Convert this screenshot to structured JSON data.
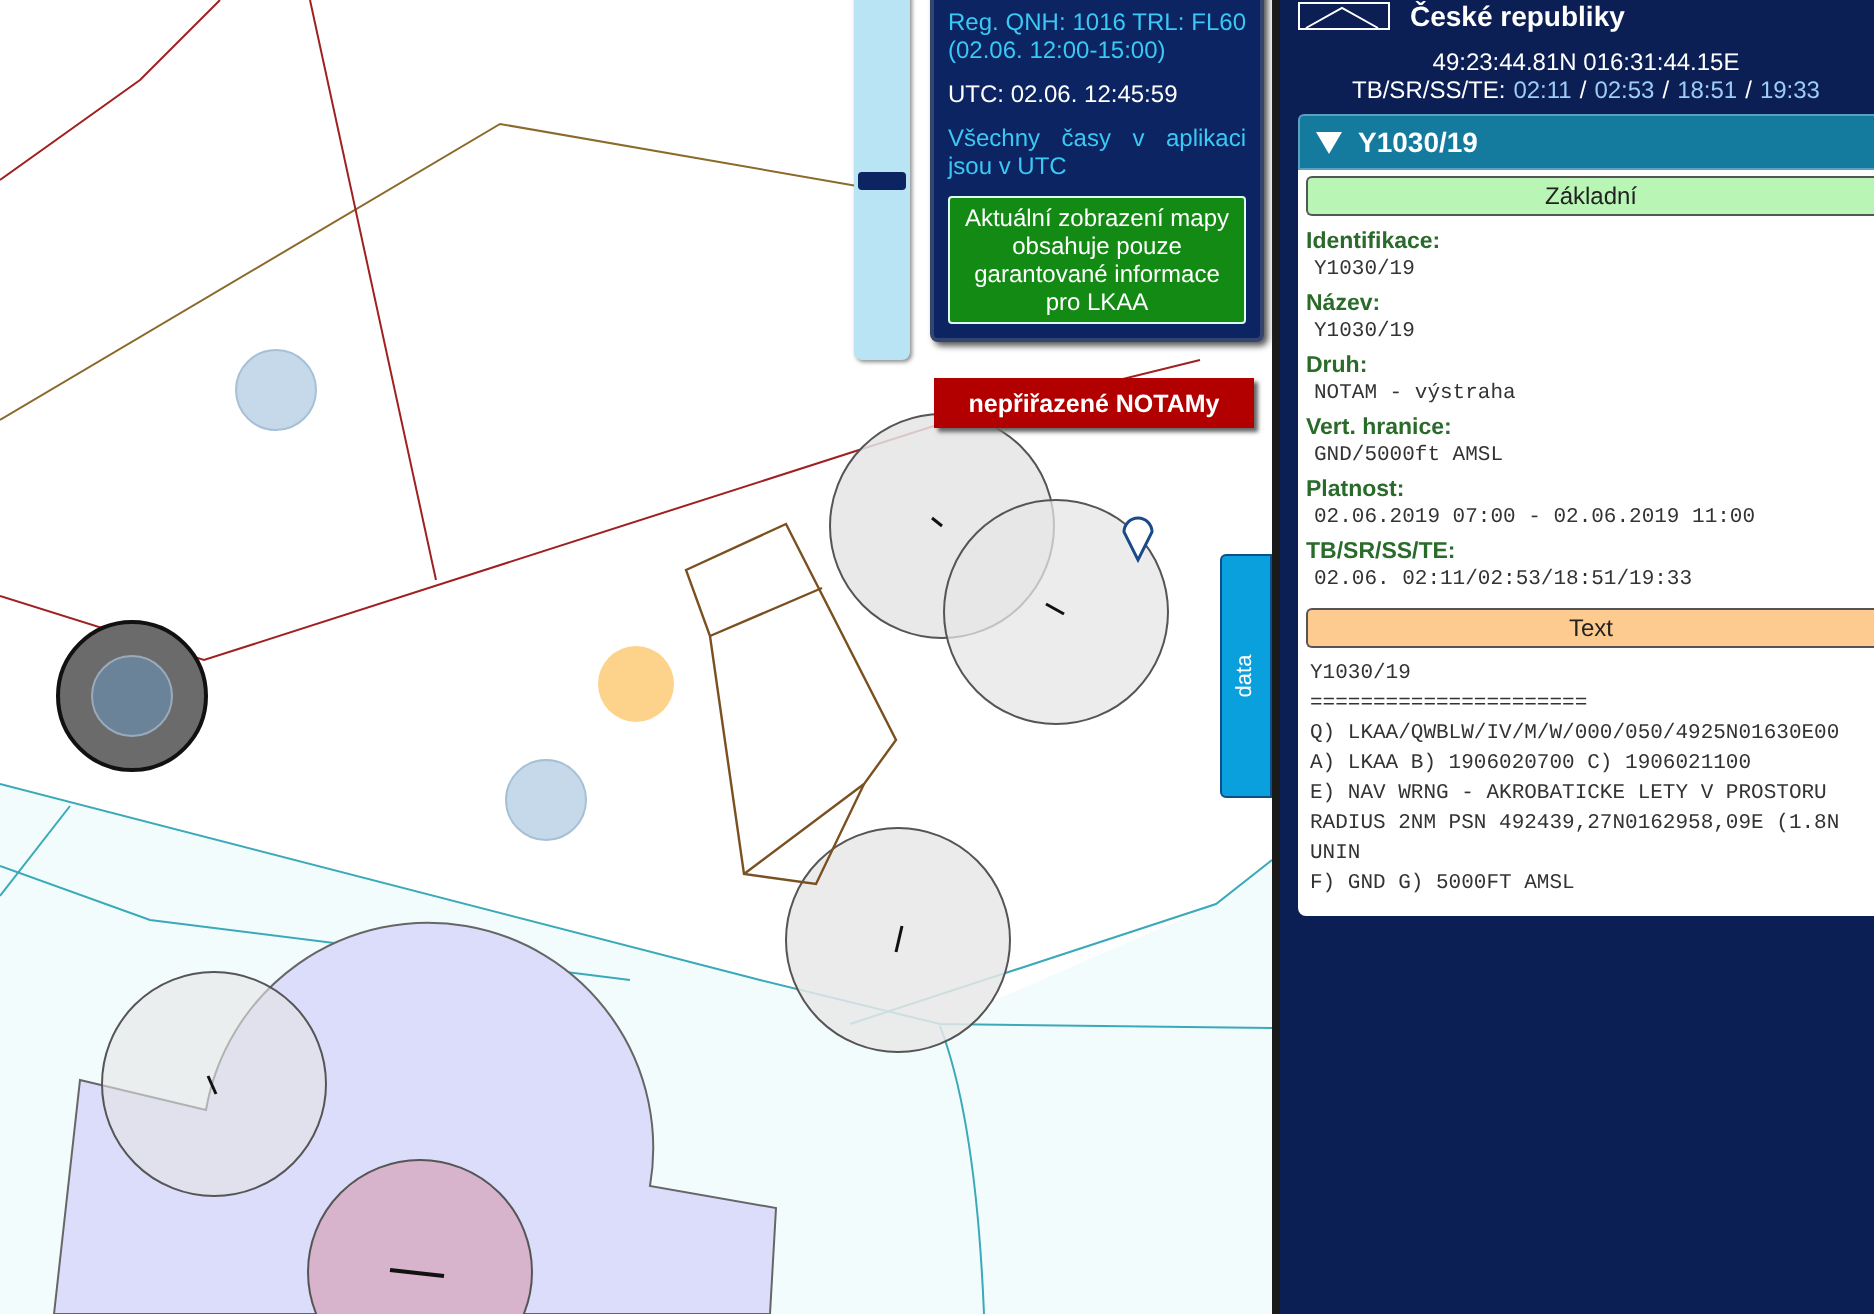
{
  "header": {
    "title": "České republiky",
    "coordinates": "49:23:44.81N 016:31:44.15E",
    "times_label": "TB/SR/SS/TE:",
    "times": [
      "02:11",
      "02:53",
      "18:51",
      "19:33"
    ],
    "separator": "/"
  },
  "map_overlay": {
    "zoom_slider": {
      "level": 0.48
    },
    "info": {
      "qnh": "Reg. QNH: 1016 TRL: FL60 (02.06. 12:00-15:00)",
      "utc": "UTC: 02.06. 12:45:59",
      "note": "Všechny časy v aplikaci jsou v UTC",
      "notice": "Aktuální zobrazení mapy obsahuje pouze garantované informace pro LKAA"
    },
    "unassigned_button": "nepřiřazené NOTAMy",
    "data_tab": "data"
  },
  "notam": {
    "id": "Y1030/19",
    "expanded": true,
    "sections": [
      {
        "kind": "fields",
        "title": "Základní",
        "fields": [
          {
            "label": "Identifikace:",
            "value": "Y1030/19"
          },
          {
            "label": "Název:",
            "value": "Y1030/19"
          },
          {
            "label": "Druh:",
            "value": "NOTAM - výstraha"
          },
          {
            "label": "Vert. hranice:",
            "value": "GND/5000ft AMSL"
          },
          {
            "label": "Platnost:",
            "value": "02.06.2019 07:00 - 02.06.2019 11:00"
          },
          {
            "label": "TB/SR/SS/TE:",
            "value": "02.06. 02:11/02:53/18:51/19:33"
          }
        ]
      },
      {
        "kind": "text",
        "title": "Text",
        "lines": [
          "Y1030/19",
          "======================",
          "Q) LKAA/QWBLW/IV/M/W/000/050/4925N01630E00",
          "A) LKAA B) 1906020700 C) 1906021100",
          "E) NAV WRNG - AKROBATICKE LETY V PROSTORU",
          "RADIUS 2NM PSN 492439,27N0162958,09E (1.8N",
          "UNIN",
          "F) GND G) 5000FT AMSL"
        ]
      }
    ]
  }
}
